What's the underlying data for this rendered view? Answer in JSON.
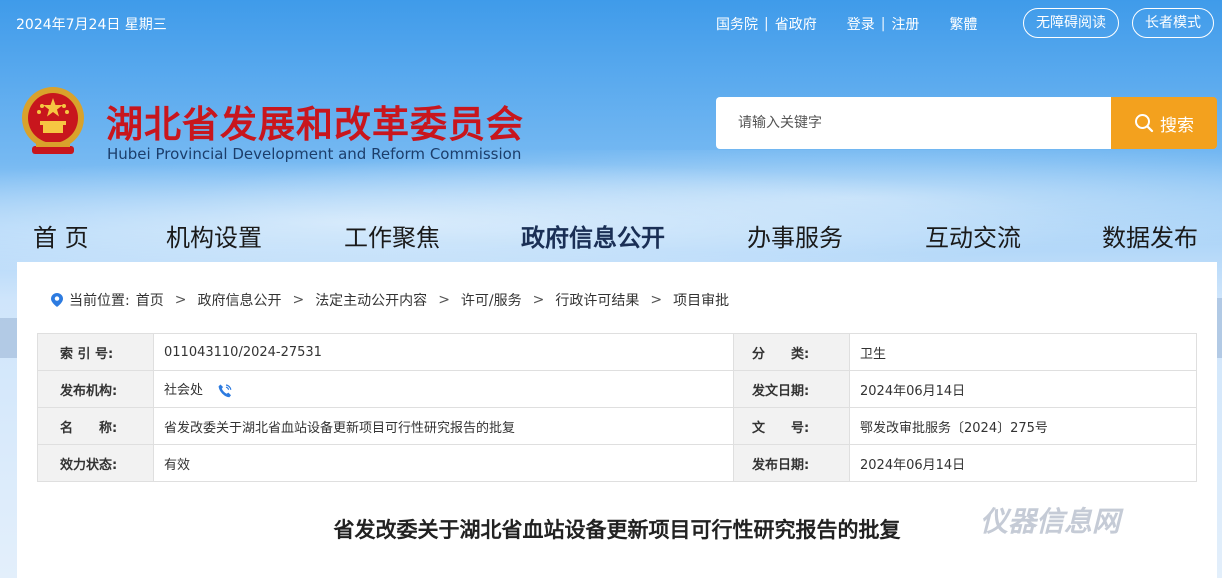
{
  "topbar": {
    "date": "2024年7月24日 星期三",
    "links": [
      "国务院",
      "省政府",
      "登录",
      "注册",
      "繁體"
    ],
    "accessibility": "无障碍阅读",
    "elder_mode": "长者模式"
  },
  "header": {
    "title": "湖北省发展和改革委员会",
    "subtitle": "Hubei Provincial Development and Reform Commission",
    "search_placeholder": "请输入关键字",
    "search_button": "搜索"
  },
  "nav": {
    "items": [
      "首 页",
      "机构设置",
      "工作聚焦",
      "政府信息公开",
      "办事服务",
      "互动交流",
      "数据发布"
    ],
    "active": "政府信息公开"
  },
  "breadcrumb": {
    "prefix": "当前位置:",
    "items": [
      "首页",
      "政府信息公开",
      "法定主动公开内容",
      "许可/服务",
      "行政许可结果",
      "项目审批"
    ]
  },
  "meta": {
    "index_label": "索 引 号:",
    "index_value": "011043110/2024-27531",
    "category_label": "分　　类:",
    "category_value": "卫生",
    "publisher_label": "发布机构:",
    "publisher_value": "社会处",
    "issue_date_label": "发文日期:",
    "issue_date_value": "2024年06月14日",
    "name_label": "名　　称:",
    "name_value": "省发改委关于湖北省血站设备更新项目可行性研究报告的批复",
    "doc_no_label": "文　　号:",
    "doc_no_value": "鄂发改审批服务〔2024〕275号",
    "status_label": "效力状态:",
    "status_value": "有效",
    "pub_date_label": "发布日期:",
    "pub_date_value": "2024年06月14日"
  },
  "document": {
    "title": "省发改委关于湖北省血站设备更新项目可行性研究报告的批复"
  },
  "watermark": "仪器信息网",
  "colors": {
    "title_red": "#c8161d",
    "search_orange": "#f3a11e",
    "pin_blue": "#2d7be0"
  }
}
